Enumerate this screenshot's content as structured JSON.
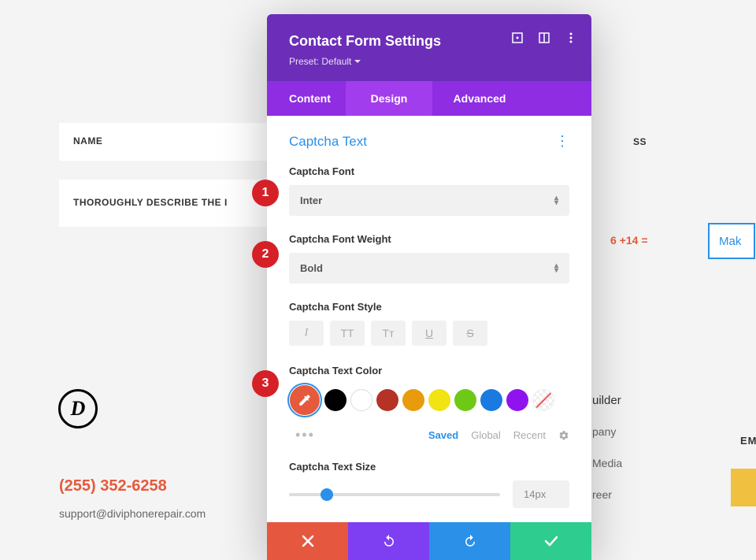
{
  "bg": {
    "name_field": "NAME",
    "desc_field": "THOROUGHLY DESCRIBE THE I",
    "address_fragment": "SS",
    "captcha_eq": "6 +14 =",
    "make_btn": "Mak",
    "builder": "uilder",
    "pany": "pany",
    "media": "Media",
    "reer": "reer",
    "em": "EM",
    "phone": "(255) 352-6258",
    "email": "support@diviphonerepair.com",
    "logo_letter": "D"
  },
  "modal": {
    "title": "Contact Form Settings",
    "preset": "Preset: Default",
    "tabs": {
      "content": "Content",
      "design": "Design",
      "advanced": "Advanced"
    },
    "section_title": "Captcha Text",
    "font_label": "Captcha Font",
    "font_value": "Inter",
    "weight_label": "Captcha Font Weight",
    "weight_value": "Bold",
    "style_label": "Captcha Font Style",
    "style_buttons": {
      "italic": "I",
      "tt_upper": "TT",
      "tt_small": "Tᴛ",
      "underline": "U",
      "strike": "S"
    },
    "color_label": "Captcha Text Color",
    "colors": {
      "picker": "#e55a3c",
      "black": "#000000",
      "white": "#ffffff",
      "darkred": "#b53224",
      "orange": "#e89b0c",
      "yellow": "#f2e314",
      "green": "#6dc916",
      "blue": "#1a7ae0",
      "purple": "#9013ef"
    },
    "color_tabs": {
      "saved": "Saved",
      "global": "Global",
      "recent": "Recent"
    },
    "size_label": "Captcha Text Size",
    "size_value": "14px"
  },
  "badges": {
    "b1": "1",
    "b2": "2",
    "b3": "3"
  }
}
